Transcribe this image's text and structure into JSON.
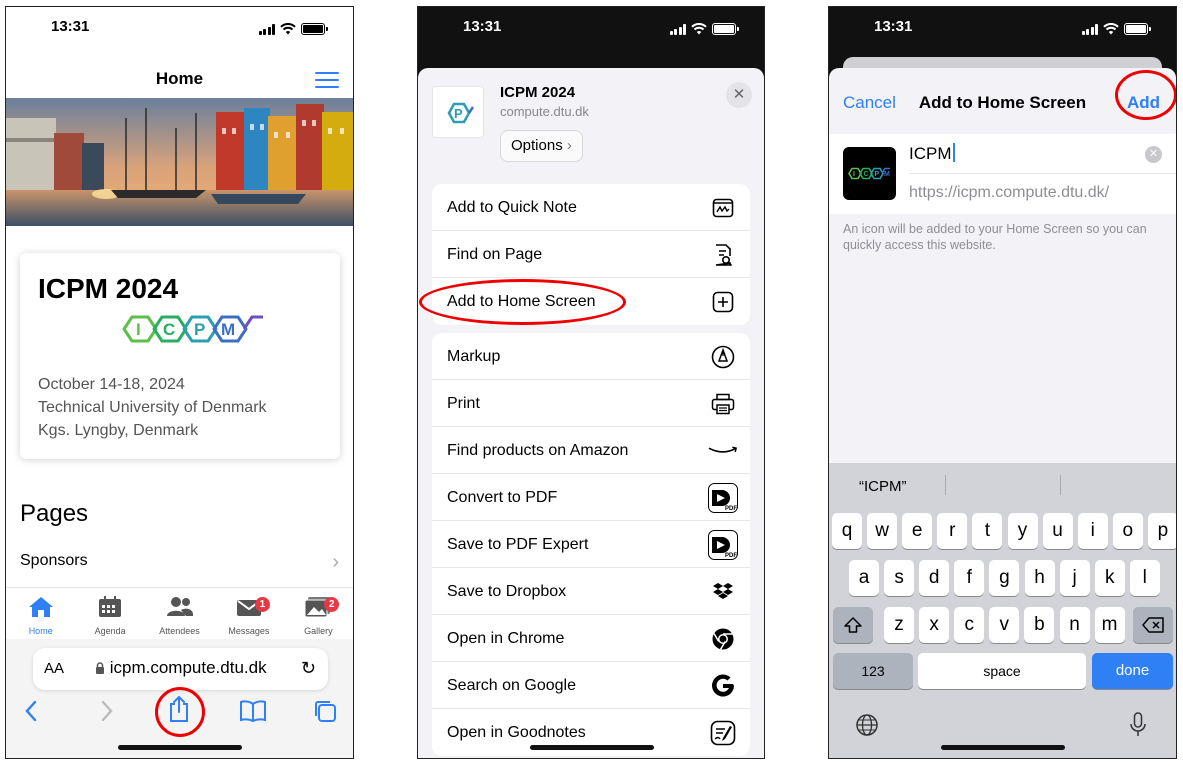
{
  "phone1": {
    "status_time": "13:31",
    "nav_title": "Home",
    "card": {
      "title": "ICPM 2024",
      "date": "October 14-18, 2024",
      "venue": "Technical University of Denmark",
      "location": "Kgs. Lyngby, Denmark"
    },
    "pages_heading": "Pages",
    "sponsors_label": "Sponsors",
    "tabs": [
      {
        "label": "Home",
        "icon": "home-icon",
        "badge": ""
      },
      {
        "label": "Agenda",
        "icon": "calendar-icon",
        "badge": ""
      },
      {
        "label": "Attendees",
        "icon": "people-icon",
        "badge": ""
      },
      {
        "label": "Messages",
        "icon": "mail-icon",
        "badge": "1"
      },
      {
        "label": "Gallery",
        "icon": "gallery-icon",
        "badge": "2"
      }
    ],
    "address": {
      "aa": "AA",
      "url": "icpm.compute.dtu.dk"
    },
    "accent": "#2f7ff5"
  },
  "phone2": {
    "status_time": "13:31",
    "site_title": "ICPM 2024",
    "site_host": "compute.dtu.dk",
    "options_label": "Options",
    "group1": [
      {
        "label": "Add to Quick Note",
        "icon": "quick-note-icon"
      },
      {
        "label": "Find on Page",
        "icon": "find-on-page-icon"
      },
      {
        "label": "Add to Home Screen",
        "icon": "add-square-icon"
      }
    ],
    "group2": [
      {
        "label": "Markup",
        "icon": "markup-icon"
      },
      {
        "label": "Print",
        "icon": "printer-icon"
      },
      {
        "label": "Find products on Amazon",
        "icon": "amazon-icon"
      },
      {
        "label": "Convert to PDF",
        "icon": "pdf-expert-icon"
      },
      {
        "label": "Save to PDF Expert",
        "icon": "pdf-expert-icon"
      },
      {
        "label": "Save to Dropbox",
        "icon": "dropbox-icon"
      },
      {
        "label": "Open in Chrome",
        "icon": "chrome-icon"
      },
      {
        "label": "Search on Google",
        "icon": "google-icon"
      },
      {
        "label": "Open in Goodnotes",
        "icon": "goodnotes-icon"
      }
    ]
  },
  "phone3": {
    "status_time": "13:31",
    "cancel_label": "Cancel",
    "title": "Add to Home Screen",
    "add_label": "Add",
    "name_value": "ICPM",
    "url_value": "https://icpm.compute.dtu.dk/",
    "hint": "An icon will be added to your Home Screen so you can quickly access this website.",
    "suggestion": "“ICPM”",
    "keyboard": {
      "row1": [
        "q",
        "w",
        "e",
        "r",
        "t",
        "y",
        "u",
        "i",
        "o",
        "p"
      ],
      "row2": [
        "a",
        "s",
        "d",
        "f",
        "g",
        "h",
        "j",
        "k",
        "l"
      ],
      "row3": [
        "z",
        "x",
        "c",
        "v",
        "b",
        "n",
        "m"
      ],
      "numbers_label": "123",
      "space_label": "space",
      "done_label": "done"
    }
  }
}
